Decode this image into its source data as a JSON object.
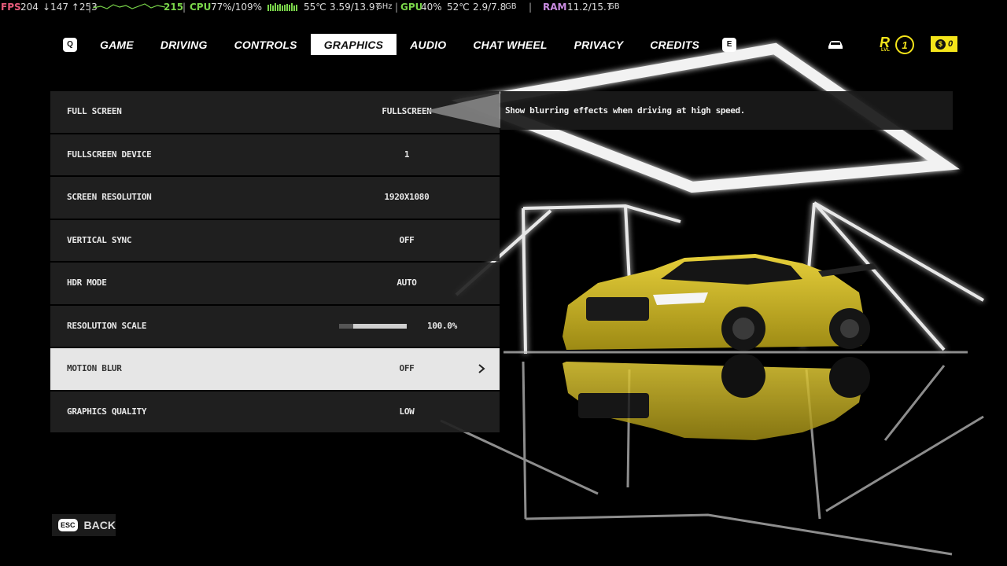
{
  "overlay": {
    "fps_label": "FPS",
    "fps_value": "204",
    "frametimes": "↓147 ↑253",
    "graph_value": "215",
    "cpu_label": "CPU",
    "cpu_value": "77%/109%",
    "cpu_temp": "55℃",
    "cpu_clock": "3.59/13.97",
    "cpu_clock_unit": "GHz",
    "gpu_label": "GPU",
    "gpu_value": "40%",
    "gpu_temp": "52℃",
    "gpu_mem": "2.9/7.8",
    "gpu_mem_unit": "GB",
    "ram_label": "RAM",
    "ram_value": "11.2/15.7",
    "ram_unit": "GB"
  },
  "nav": {
    "left_key": "Q",
    "right_key": "E",
    "tabs": [
      {
        "label": "GAME"
      },
      {
        "label": "DRIVING"
      },
      {
        "label": "CONTROLS"
      },
      {
        "label": "GRAPHICS",
        "active": true
      },
      {
        "label": "AUDIO"
      },
      {
        "label": "CHAT WHEEL"
      },
      {
        "label": "PRIVACY"
      },
      {
        "label": "CREDITS"
      }
    ]
  },
  "status": {
    "rep_letter": "R",
    "rep_level_label": "LVL",
    "rep_level": "1",
    "cash_value": "0"
  },
  "settings": [
    {
      "label": "FULL SCREEN",
      "value": "FULLSCREEN"
    },
    {
      "label": "FULLSCREEN DEVICE",
      "value": "1"
    },
    {
      "label": "SCREEN RESOLUTION",
      "value": "1920X1080"
    },
    {
      "label": "VERTICAL SYNC",
      "value": "OFF"
    },
    {
      "label": "HDR MODE",
      "value": "AUTO"
    },
    {
      "label": "RESOLUTION SCALE",
      "value": "100.0%",
      "slider_fraction": 1.0
    },
    {
      "label": "MOTION BLUR",
      "value": "OFF",
      "selected": true
    },
    {
      "label": "GRAPHICS QUALITY",
      "value": "LOW"
    }
  ],
  "description": "Show blurring effects when driving at high speed.",
  "back": {
    "key": "ESC",
    "label": "BACK"
  },
  "colors": {
    "accent_yellow": "#f4e41a",
    "selected_row": "#e6e6e6",
    "row_bg": "#222222"
  }
}
